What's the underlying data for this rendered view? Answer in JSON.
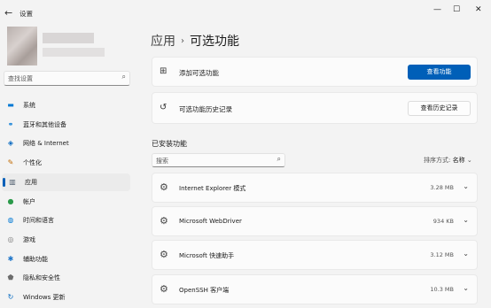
{
  "window": {
    "title": "设置",
    "back_icon": "←",
    "minimize": "—",
    "maximize": "☐",
    "close": "✕"
  },
  "sidebar": {
    "search_placeholder": "查找设置",
    "search_icon": "⌕",
    "items": [
      {
        "label": "系统",
        "icon": "monitor-icon",
        "glyph": "▬",
        "color": "#0078d4"
      },
      {
        "label": "蓝牙和其他设备",
        "icon": "bluetooth-icon",
        "glyph": "⚭",
        "color": "#0078d4"
      },
      {
        "label": "网络 & Internet",
        "icon": "wifi-icon",
        "glyph": "◈",
        "color": "#0067c0"
      },
      {
        "label": "个性化",
        "icon": "brush-icon",
        "glyph": "✎",
        "color": "#c16a00"
      },
      {
        "label": "应用",
        "icon": "apps-icon",
        "glyph": "▥",
        "color": "#4a5a6a"
      },
      {
        "label": "帐户",
        "icon": "account-icon",
        "glyph": "●",
        "color": "#2b9a4a"
      },
      {
        "label": "时间和语言",
        "icon": "globe-icon",
        "glyph": "◍",
        "color": "#0078d4"
      },
      {
        "label": "游戏",
        "icon": "gamepad-icon",
        "glyph": "◎",
        "color": "#7a7a7a"
      },
      {
        "label": "辅助功能",
        "icon": "accessibility-icon",
        "glyph": "✱",
        "color": "#1a73c8"
      },
      {
        "label": "隐私和安全性",
        "icon": "shield-icon",
        "glyph": "⬟",
        "color": "#6c6c6c"
      },
      {
        "label": "Windows 更新",
        "icon": "update-icon",
        "glyph": "↻",
        "color": "#0067c0"
      }
    ],
    "selected_index": 4
  },
  "header": {
    "parent": "应用",
    "separator": "›",
    "current": "可选功能"
  },
  "actions": {
    "add": {
      "label": "添加可选功能",
      "button": "查看功能",
      "icon_glyph": "⊞"
    },
    "history": {
      "label": "可选功能历史记录",
      "button": "查看历史记录",
      "icon_glyph": "↺"
    }
  },
  "installed": {
    "title": "已安装功能",
    "search_placeholder": "搜索",
    "search_icon": "⌕",
    "sort_label": "排序方式:",
    "sort_value": "名称",
    "sort_chevron": "⌄",
    "feature_glyph": "⚙",
    "chevron": "⌄",
    "items": [
      {
        "name": "Internet Explorer 模式",
        "size": "3.28 MB"
      },
      {
        "name": "Microsoft WebDriver",
        "size": "934 KB"
      },
      {
        "name": "Microsoft 快速助手",
        "size": "3.12 MB"
      },
      {
        "name": "OpenSSH 客户端",
        "size": "10.3 MB"
      }
    ]
  },
  "colors": {
    "accent": "#005fb8",
    "background": "#f3f3f3",
    "card": "#fbfbfb"
  }
}
